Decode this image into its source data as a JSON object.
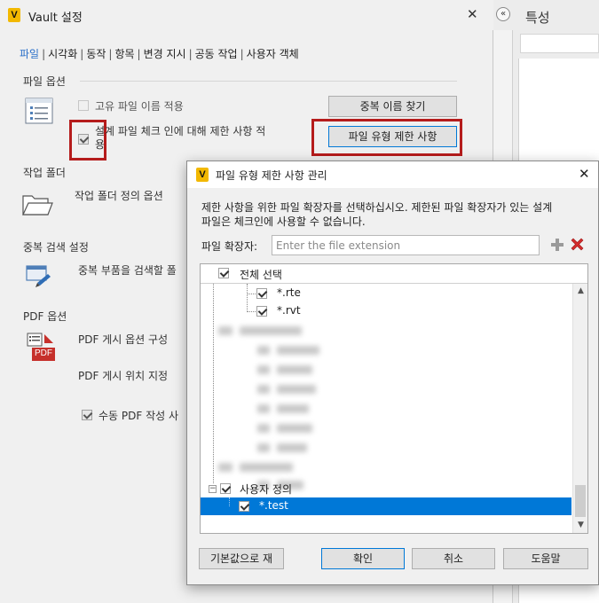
{
  "vault_window": {
    "logo": "V",
    "title": "Vault 설정",
    "close": "✕",
    "tabs": [
      {
        "label": "파일",
        "active": true
      },
      {
        "label": "시각화"
      },
      {
        "label": "동작"
      },
      {
        "label": "항목"
      },
      {
        "label": "변경 지시"
      },
      {
        "label": "공동 작업"
      },
      {
        "label": "사용자 객체"
      }
    ],
    "tab_separator": "|",
    "sections": {
      "file_options": {
        "heading": "파일 옵션",
        "icon": "list-document-icon",
        "unique_name_label": "고유 파일 이름 적용",
        "unique_name_checked": false,
        "restriction_label": "설계 파일 체크 인에 대해 제한 사항 적용",
        "restriction_label_line1": "설계 파일 체크 인에 대해 제한 사항 적",
        "restriction_label_line2": "용",
        "restriction_checked": true,
        "find_duplicate_button": "중복 이름 찾기",
        "file_type_restriction_button": "파일 유형 제한 사항"
      },
      "working_folder": {
        "heading": "작업 폴더",
        "icon": "folder-icon",
        "option_label": "작업 폴더 정의 옵션"
      },
      "duplicate_search": {
        "heading": "중복 검색 설정",
        "icon": "search-settings-icon",
        "option_label": "중복 부품을 검색할 폴"
      },
      "pdf_options": {
        "heading": "PDF 옵션",
        "icon": "pdf-icon",
        "icon_text": "PDF",
        "publish_options_label": "PDF 게시 옵션 구성",
        "publish_location_label": "PDF 게시 위치 지정",
        "manual_pdf_label": "수동 PDF 작성 사",
        "manual_pdf_checked": true
      }
    }
  },
  "right_panel": {
    "collapse_glyph": "«",
    "title": "특성"
  },
  "dialog": {
    "logo": "V",
    "title": "파일 유형 제한 사항 관리",
    "close": "✕",
    "description": "제한 사항을 위한 파일 확장자를 선택하십시오. 제한된 파일 확장자가 있는 설계 파일은 체크인에 사용할 수 없습니다.",
    "description_line1": "제한 사항을 위한 파일 확장자를 선택하십시오. 제한된 파일 확장자가 있는 설계",
    "description_line2": "파일은 체크인에 사용할 수 없습니다.",
    "extension_label": "파일 확장자:",
    "extension_value": "",
    "extension_placeholder": "Enter the file extension",
    "add_icon": "plus-icon",
    "delete_icon": "delete-x-icon",
    "tree": {
      "select_all_label": "전체 선택",
      "select_all_checked": true,
      "visible_items": [
        {
          "label": "*.rte",
          "checked": true
        },
        {
          "label": "*.rvt",
          "checked": true
        }
      ],
      "custom_group": {
        "label": "사용자 정의",
        "checked": true,
        "expander": "−"
      },
      "custom_items": [
        {
          "label": "*.test",
          "checked": true,
          "selected": true
        }
      ]
    },
    "buttons": {
      "reset": "기본값으로 재",
      "ok": "확인",
      "cancel": "취소",
      "help": "도움말"
    },
    "colors": {
      "selection": "#0078d7",
      "highlight_box": "#b51c1c",
      "link_active": "#2a6fc9"
    }
  }
}
